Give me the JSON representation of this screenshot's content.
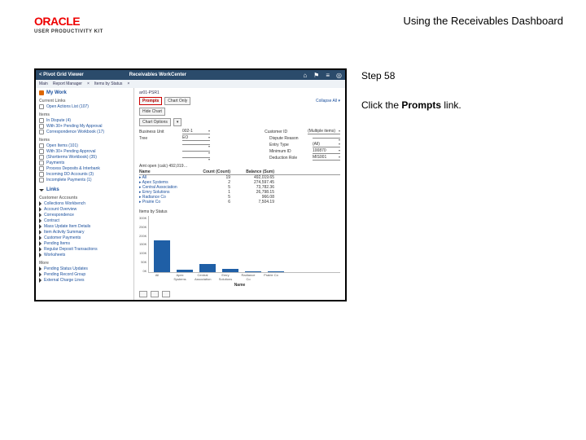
{
  "header": {
    "brand": "ORACLE",
    "kit": "USER PRODUCTIVITY KIT",
    "doc_title": "Using the Receivables Dashboard"
  },
  "instruction": {
    "step": "Step 58",
    "line1": "Click the ",
    "bold": "Prompts",
    "line2": " link."
  },
  "shot": {
    "topbar": {
      "back": "<  Pivot Grid Viewer",
      "center": "Receivables WorkCenter",
      "icons": {
        "home": "⌂",
        "flag": "⚑",
        "menu": "≡",
        "gear": "◎"
      }
    },
    "toolbar": {
      "a": "Main",
      "b": "Report Manager",
      "c": "×",
      "d": "Items by Status",
      "e": "×"
    },
    "sidebar": {
      "mywork": "My Work",
      "mywork_right": "ই  ◯",
      "groups": [
        {
          "name": "Current Links",
          "items": [
            "Open Actions List (107)"
          ]
        },
        {
          "name": "Items",
          "items": [
            "In Dispute (4)",
            "With 30+ Pending My Approval",
            "Correspondence Workbook (17)"
          ]
        },
        {
          "name": "Items",
          "items": [
            "Open Items (101)",
            "With 30+ Pending Approval",
            "(Shortterms Workbook) (35)",
            "Payments",
            "Process Deposits & Interbank",
            "Incoming DD Accounts (3)",
            "Incomplete Payments (1)"
          ]
        }
      ],
      "links": "Links",
      "lgroups": [
        {
          "name": "Customer Accounts",
          "items": [
            "Collections Workbench",
            "Account Overview",
            "Correspondence",
            "Contract",
            "Mass Update Item Details",
            "Item Activity Summary",
            "Customer Payments",
            "Pending Items",
            "Regular Deposit Transactions",
            "Worksheets"
          ]
        },
        {
          "name": "More",
          "items": [
            "Pending Status Updates",
            "Pending Record Group",
            "External Charge Lines"
          ]
        }
      ]
    },
    "main": {
      "crumb": "ar01-PSR1",
      "controls": {
        "prompts": "Prompts",
        "chart_only": "Chart Only",
        "hide_chart": "Hide Chart",
        "chart_options": "Chart Options",
        "more": "▾"
      },
      "collapse": "Collapse All  ▾",
      "fields": [
        {
          "l": "Business Unit",
          "v": "002-1",
          "rl": "Customer  ID",
          "rv": "(Multiple items)"
        },
        {
          "l": "Tree",
          "v": "EO",
          "rl": "Dispute Reason",
          "rv": ""
        },
        {
          "l": "",
          "v": "",
          "rl": "Entry Type",
          "rv": "(All)"
        },
        {
          "l": "",
          "v": "",
          "rl": "Minimum ID",
          "rv": "100870"
        },
        {
          "l": "",
          "v": "",
          "rl": "Deduction Role",
          "rv": "MIS001"
        }
      ],
      "table": {
        "title": "Amt open (calc)  492,019…",
        "cols": [
          "Name",
          "Count (Count)",
          "Balance (Sum)"
        ]
      },
      "chart_title": "Items by Status",
      "chart_xlabel": "Name",
      "footer_icons": [
        "a",
        "b",
        "c"
      ]
    }
  },
  "chart_data": {
    "type": "bar",
    "title": "Items by Status",
    "xlabel": "Name",
    "ylabel": "",
    "ylim": [
      0,
      300000
    ],
    "yticks": [
      "300K",
      "250K",
      "200K",
      "150K",
      "100K",
      "50K",
      "0K"
    ],
    "categories": [
      "All",
      "Apex Systems",
      "Central Association",
      "Emry Solutions",
      "Radiance Co",
      "Prairie Co"
    ],
    "series": [
      {
        "name": "Count (Count)",
        "values": [
          19,
          2,
          5,
          1,
          5,
          6
        ]
      },
      {
        "name": "Balance (Sum)",
        "values": [
          492019.65,
          274597.45,
          73782.36,
          26798.15,
          966.08,
          7504.19
        ]
      }
    ],
    "bar_heights_pct": [
      56,
      4,
      15,
      6,
      2,
      2
    ]
  }
}
